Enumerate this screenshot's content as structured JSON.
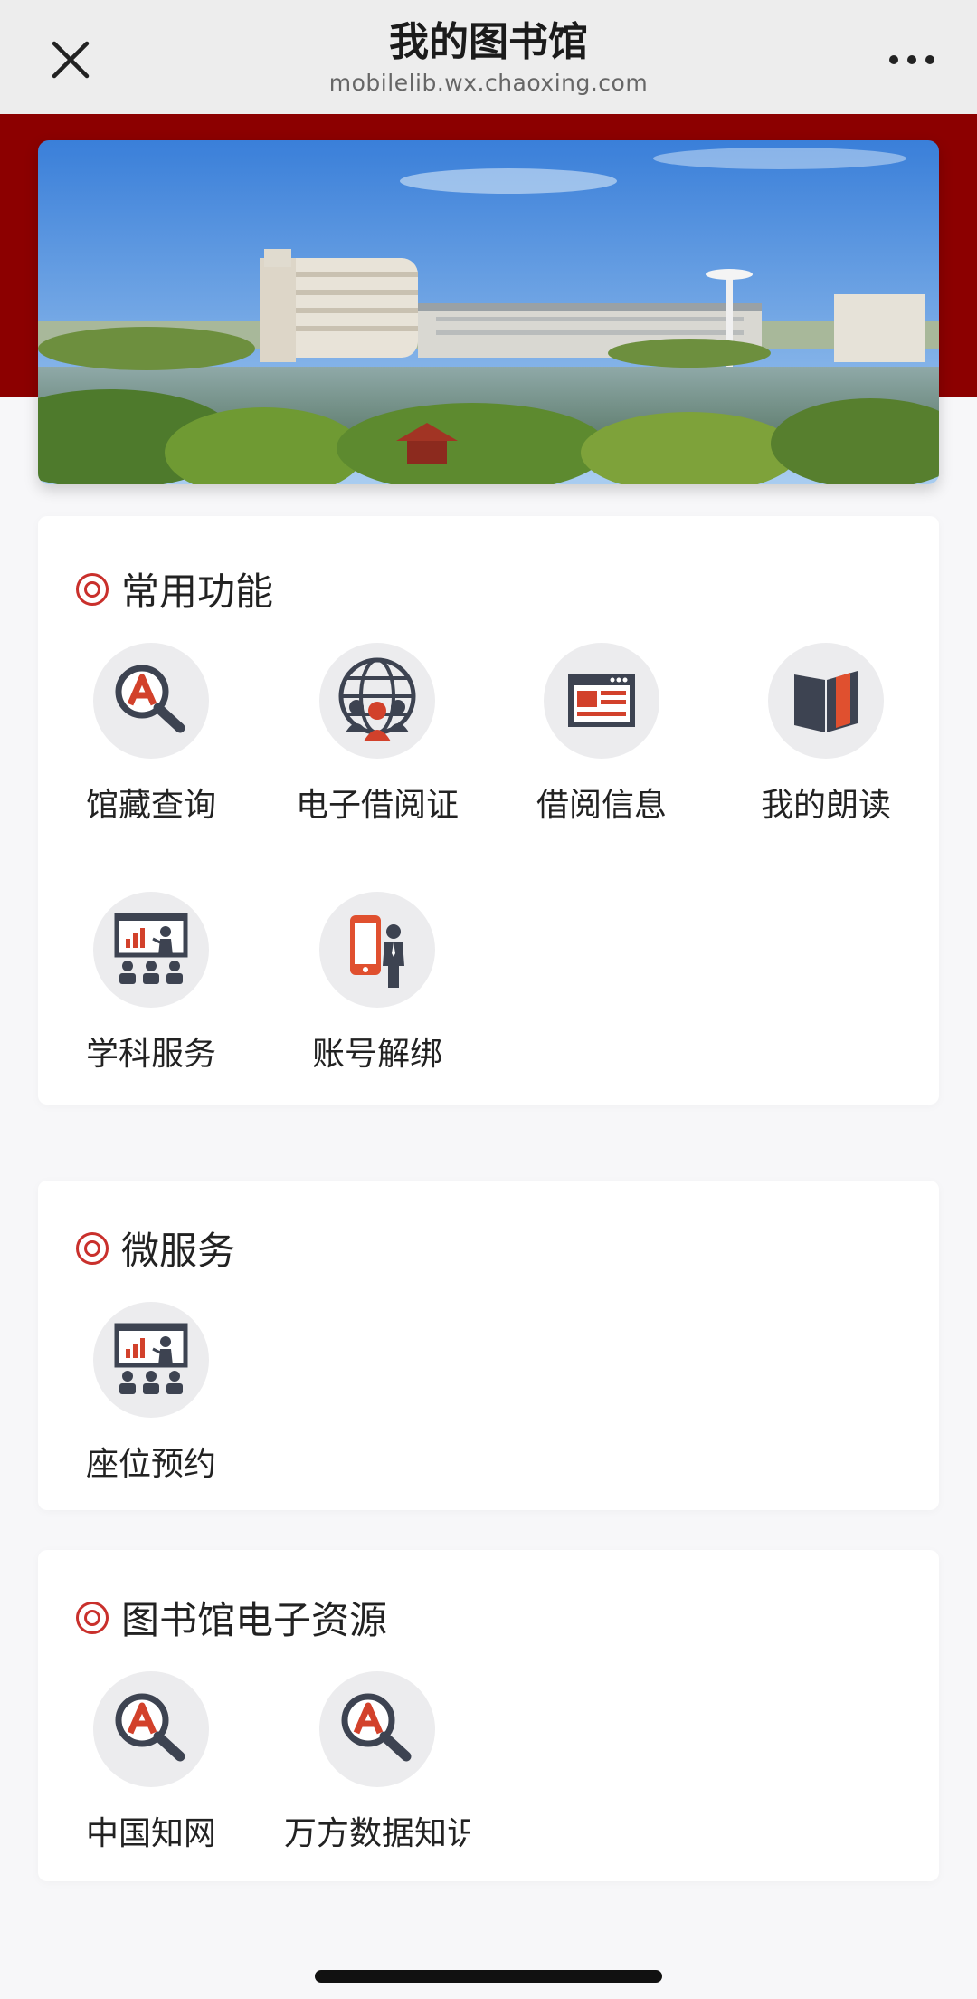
{
  "header": {
    "title": "我的图书馆",
    "url": "mobilelib.wx.chaoxing.com",
    "close_icon": "close-icon",
    "more_icon": "more-dots-icon"
  },
  "colors": {
    "brand_red": "#8c0000",
    "accent_red": "#c9302c",
    "icon_dark": "#3d4351",
    "icon_bg": "#ececee"
  },
  "sections": {
    "common": {
      "title": "常用功能",
      "items": [
        {
          "label": "馆藏查询",
          "icon": "search-a-icon"
        },
        {
          "label": "电子借阅证",
          "icon": "globe-people-icon"
        },
        {
          "label": "借阅信息",
          "icon": "news-card-icon"
        },
        {
          "label": "我的朗读",
          "icon": "book-icon"
        },
        {
          "label": "学科服务",
          "icon": "presentation-icon"
        },
        {
          "label": "账号解绑",
          "icon": "phone-person-icon"
        }
      ]
    },
    "micro": {
      "title": "微服务",
      "items": [
        {
          "label": "座位预约",
          "icon": "presentation-icon"
        }
      ]
    },
    "eresources": {
      "title": "图书馆电子资源",
      "items": [
        {
          "label": "中国知网",
          "icon": "search-a-icon"
        },
        {
          "label": "万方数据知识",
          "icon": "search-a-icon"
        }
      ]
    }
  }
}
